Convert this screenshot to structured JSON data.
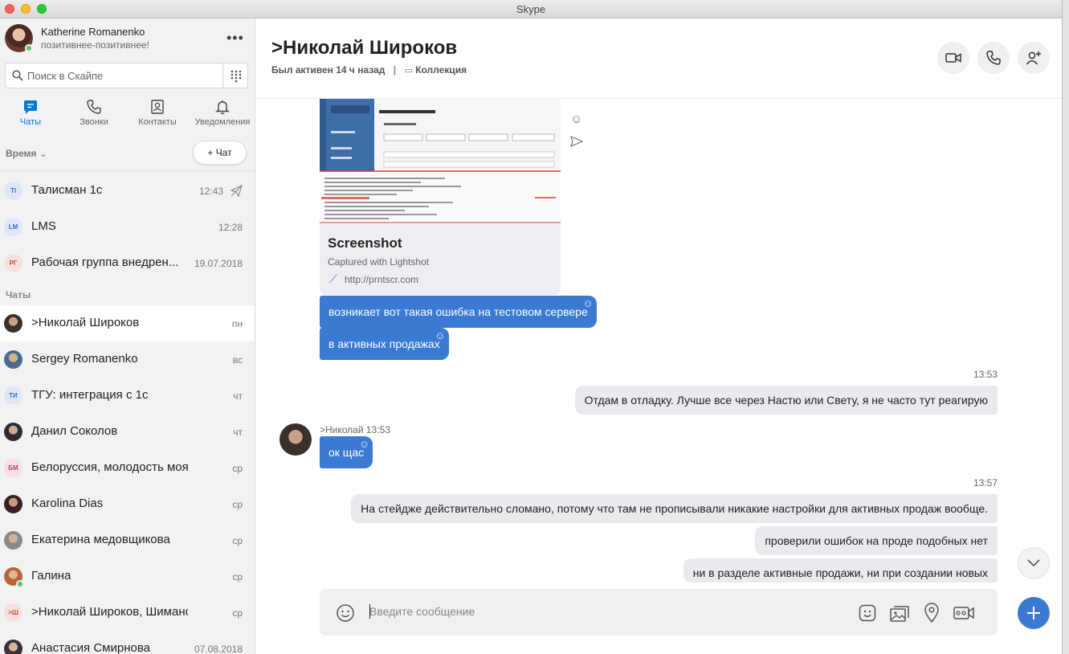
{
  "window": {
    "title": "Skype"
  },
  "colors": {
    "accent": "#0078d4",
    "bubble_in": "#3a7ad3",
    "bubble_out": "#eaeaee",
    "online": "#5ac35a"
  },
  "profile": {
    "name": "Katherine Romanenko",
    "status": "позитивнее-позитивнее!"
  },
  "search": {
    "placeholder": "Поиск в Скайпе"
  },
  "nav": [
    {
      "label": "Чаты",
      "icon": "chat-icon"
    },
    {
      "label": "Звонки",
      "icon": "phone-icon"
    },
    {
      "label": "Контакты",
      "icon": "contacts-icon"
    },
    {
      "label": "Уведомления",
      "icon": "bell-icon"
    }
  ],
  "sort_label": "Время",
  "new_chat_label": "+ Чат",
  "recent": [
    {
      "initials": "ТІ",
      "name": "Талисман 1с",
      "time": "12:43",
      "muted": true
    },
    {
      "initials": "LM",
      "name": "LMS",
      "time": "12:28"
    },
    {
      "initials": "РГ",
      "name": "Рабочая группа внедрен...",
      "time": "19.07.2018"
    }
  ],
  "chats_section": "Чаты",
  "chats": [
    {
      "name": ">Николай Широков",
      "time": "пн",
      "selected": true
    },
    {
      "name": "Sergey Romanenko",
      "time": "вс"
    },
    {
      "initials": "ТИ",
      "name": "ТГУ: интеграция с 1с",
      "time": "чт"
    },
    {
      "name": "Данил Соколов",
      "time": "чт"
    },
    {
      "initials": "БМ",
      "name": "Белоруссия, молодость моя...",
      "time": "ср"
    },
    {
      "name": "Karolina Dias",
      "time": "ср"
    },
    {
      "name": "Екатерина медовщикова",
      "time": "ср"
    },
    {
      "name": "Галина",
      "time": "ср"
    },
    {
      "initials": ">Ш",
      "name": ">Николай Широков, Шиманска...",
      "time": "ср"
    },
    {
      "name": "Анастасия Смирнова",
      "time": "07.08.2018"
    }
  ],
  "header": {
    "title": ">Николай Широков",
    "last_seen": "Был активен 14 ч назад",
    "separator": "|",
    "collection": "Коллекция"
  },
  "link_card": {
    "title": "Screenshot",
    "description": "Captured with Lightshot",
    "url": "http://prntscr.com"
  },
  "messages": {
    "in1": "возникает вот такая ошибка на тестовом сервере",
    "in2": "в активных продажах",
    "time1": "13:53",
    "out1": "Отдам в отладку. Лучше все через Настю или Свету, я не часто тут реагирую",
    "sender": ">Николай 13:53",
    "in3": "ок щас",
    "time2": "13:57",
    "out2": "На стейдже действительно сломано, потому что там не прописывали никакие настройки для активных продаж вообще.",
    "out3": "проверили ошибок на проде подобных нет",
    "out4": "ни в разделе активные продажи, ни при создании новых"
  },
  "composer": {
    "placeholder": "Введите сообщение"
  }
}
